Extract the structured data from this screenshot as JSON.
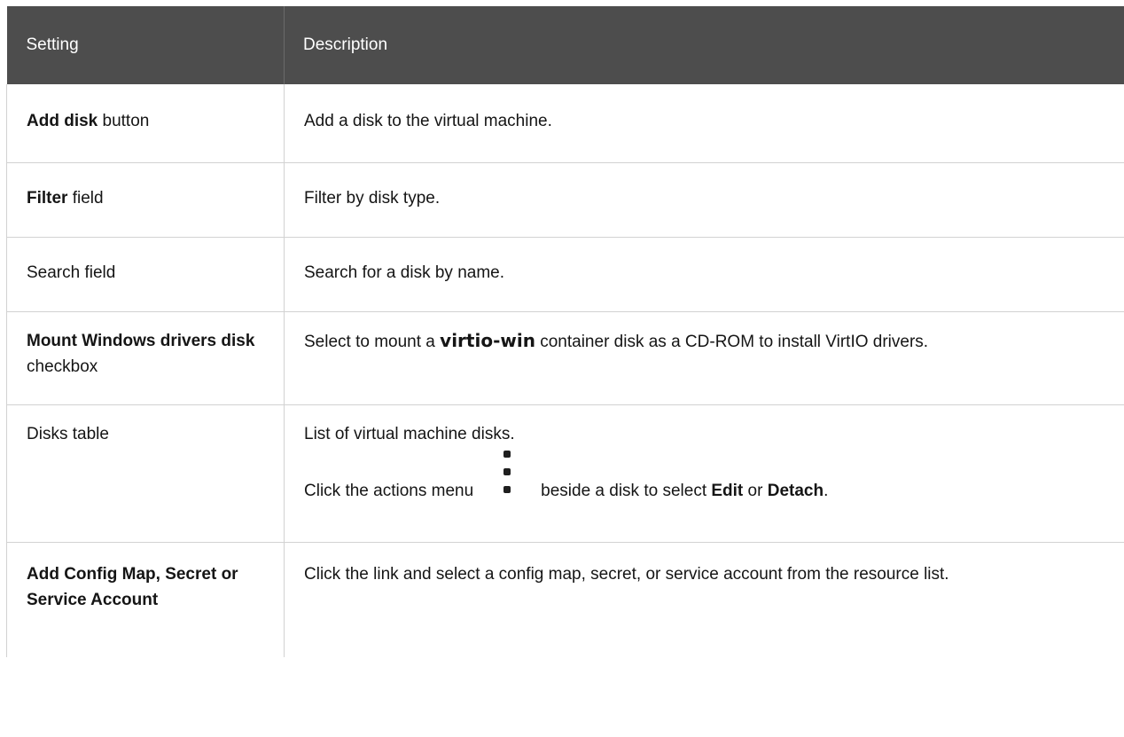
{
  "header": {
    "setting": "Setting",
    "description": "Description"
  },
  "rows": [
    {
      "setting_bold": "Add disk",
      "setting_rest": " button",
      "description": "Add a disk to the virtual machine."
    },
    {
      "setting_bold": "Filter",
      "setting_rest": " field",
      "description": "Filter by disk type."
    },
    {
      "setting_plain": "Search field",
      "description": "Search for a disk by name."
    },
    {
      "setting_bold": "Mount Windows drivers disk",
      "setting_rest": " checkbox",
      "description_pre": "Select to mount a ",
      "description_code": "virtio-win",
      "description_post": " container disk as a CD-ROM to install VirtIO drivers."
    },
    {
      "setting_plain": "Disks table",
      "description": "List of virtual machine disks.",
      "actions_pre": "Click the actions menu ",
      "actions_icon": "kebab-menu-icon",
      "actions_mid": " beside a disk to select ",
      "actions_edit": "Edit",
      "actions_or": " or ",
      "actions_detach": "Detach",
      "actions_end": "."
    },
    {
      "setting_bold": "Add Config Map, Secret or Service Account",
      "description": "Click the link and select a config map, secret, or service account from the resource list."
    }
  ]
}
